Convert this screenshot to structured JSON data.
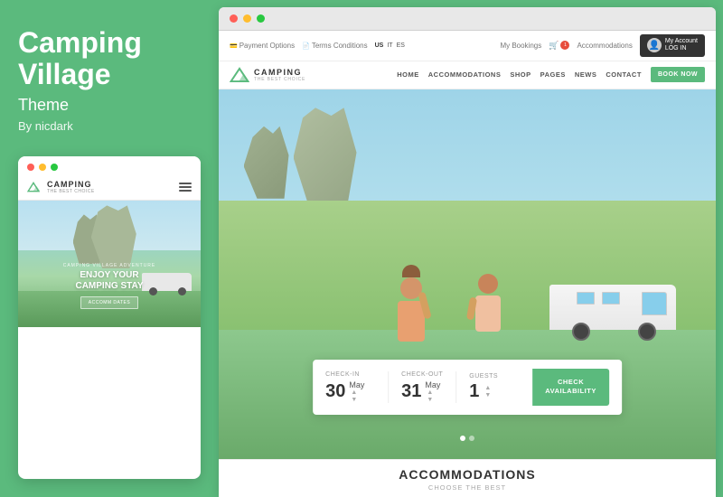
{
  "left": {
    "title_line1": "Camping",
    "title_line2": "Village",
    "subtitle": "Theme",
    "by": "By nicdark",
    "mobile": {
      "brand_name": "CAMPING",
      "brand_tagline": "THE BEST CHOICE",
      "adventure_label": "CAMPING VILLAGE ADVENTURE",
      "main_heading_line1": "ENJOY YOUR",
      "main_heading_line2": "CAMPING STAY",
      "cta_label": "ACCOMM DATES"
    }
  },
  "browser": {
    "topbar": {
      "payment_options": "Payment Options",
      "terms_conditions": "Terms Conditions",
      "lang_us": "US",
      "lang_it": "IT",
      "lang_es": "ES",
      "my_bookings": "My Bookings",
      "accommodations": "Accommodations",
      "my_account_label": "My Account",
      "log_in_label": "LOG IN"
    },
    "nav": {
      "brand_name": "CAMPING",
      "brand_tagline": "THE BEST CHOICE",
      "items": [
        {
          "label": "HOME",
          "active": false
        },
        {
          "label": "ACCOMMODATIONS",
          "active": false
        },
        {
          "label": "SHOP",
          "active": false
        },
        {
          "label": "PAGES",
          "active": false
        },
        {
          "label": "NEWS",
          "active": false
        },
        {
          "label": "CONTACT",
          "active": false
        }
      ],
      "book_now": "BOOK NOW"
    },
    "booking": {
      "checkin_label": "CHECK-IN",
      "checkin_day": "30",
      "checkin_month": "May",
      "checkout_label": "CHECK-OUT",
      "checkout_day": "31",
      "checkout_month": "May",
      "guests_label": "GUESTS",
      "guests_value": "1",
      "check_avail_line1": "CHECK",
      "check_avail_line2": "AVAILABILITY"
    },
    "accommodations": {
      "title": "ACCOMMODATIONS",
      "subtitle": "CHOOSE THE BEST"
    }
  }
}
